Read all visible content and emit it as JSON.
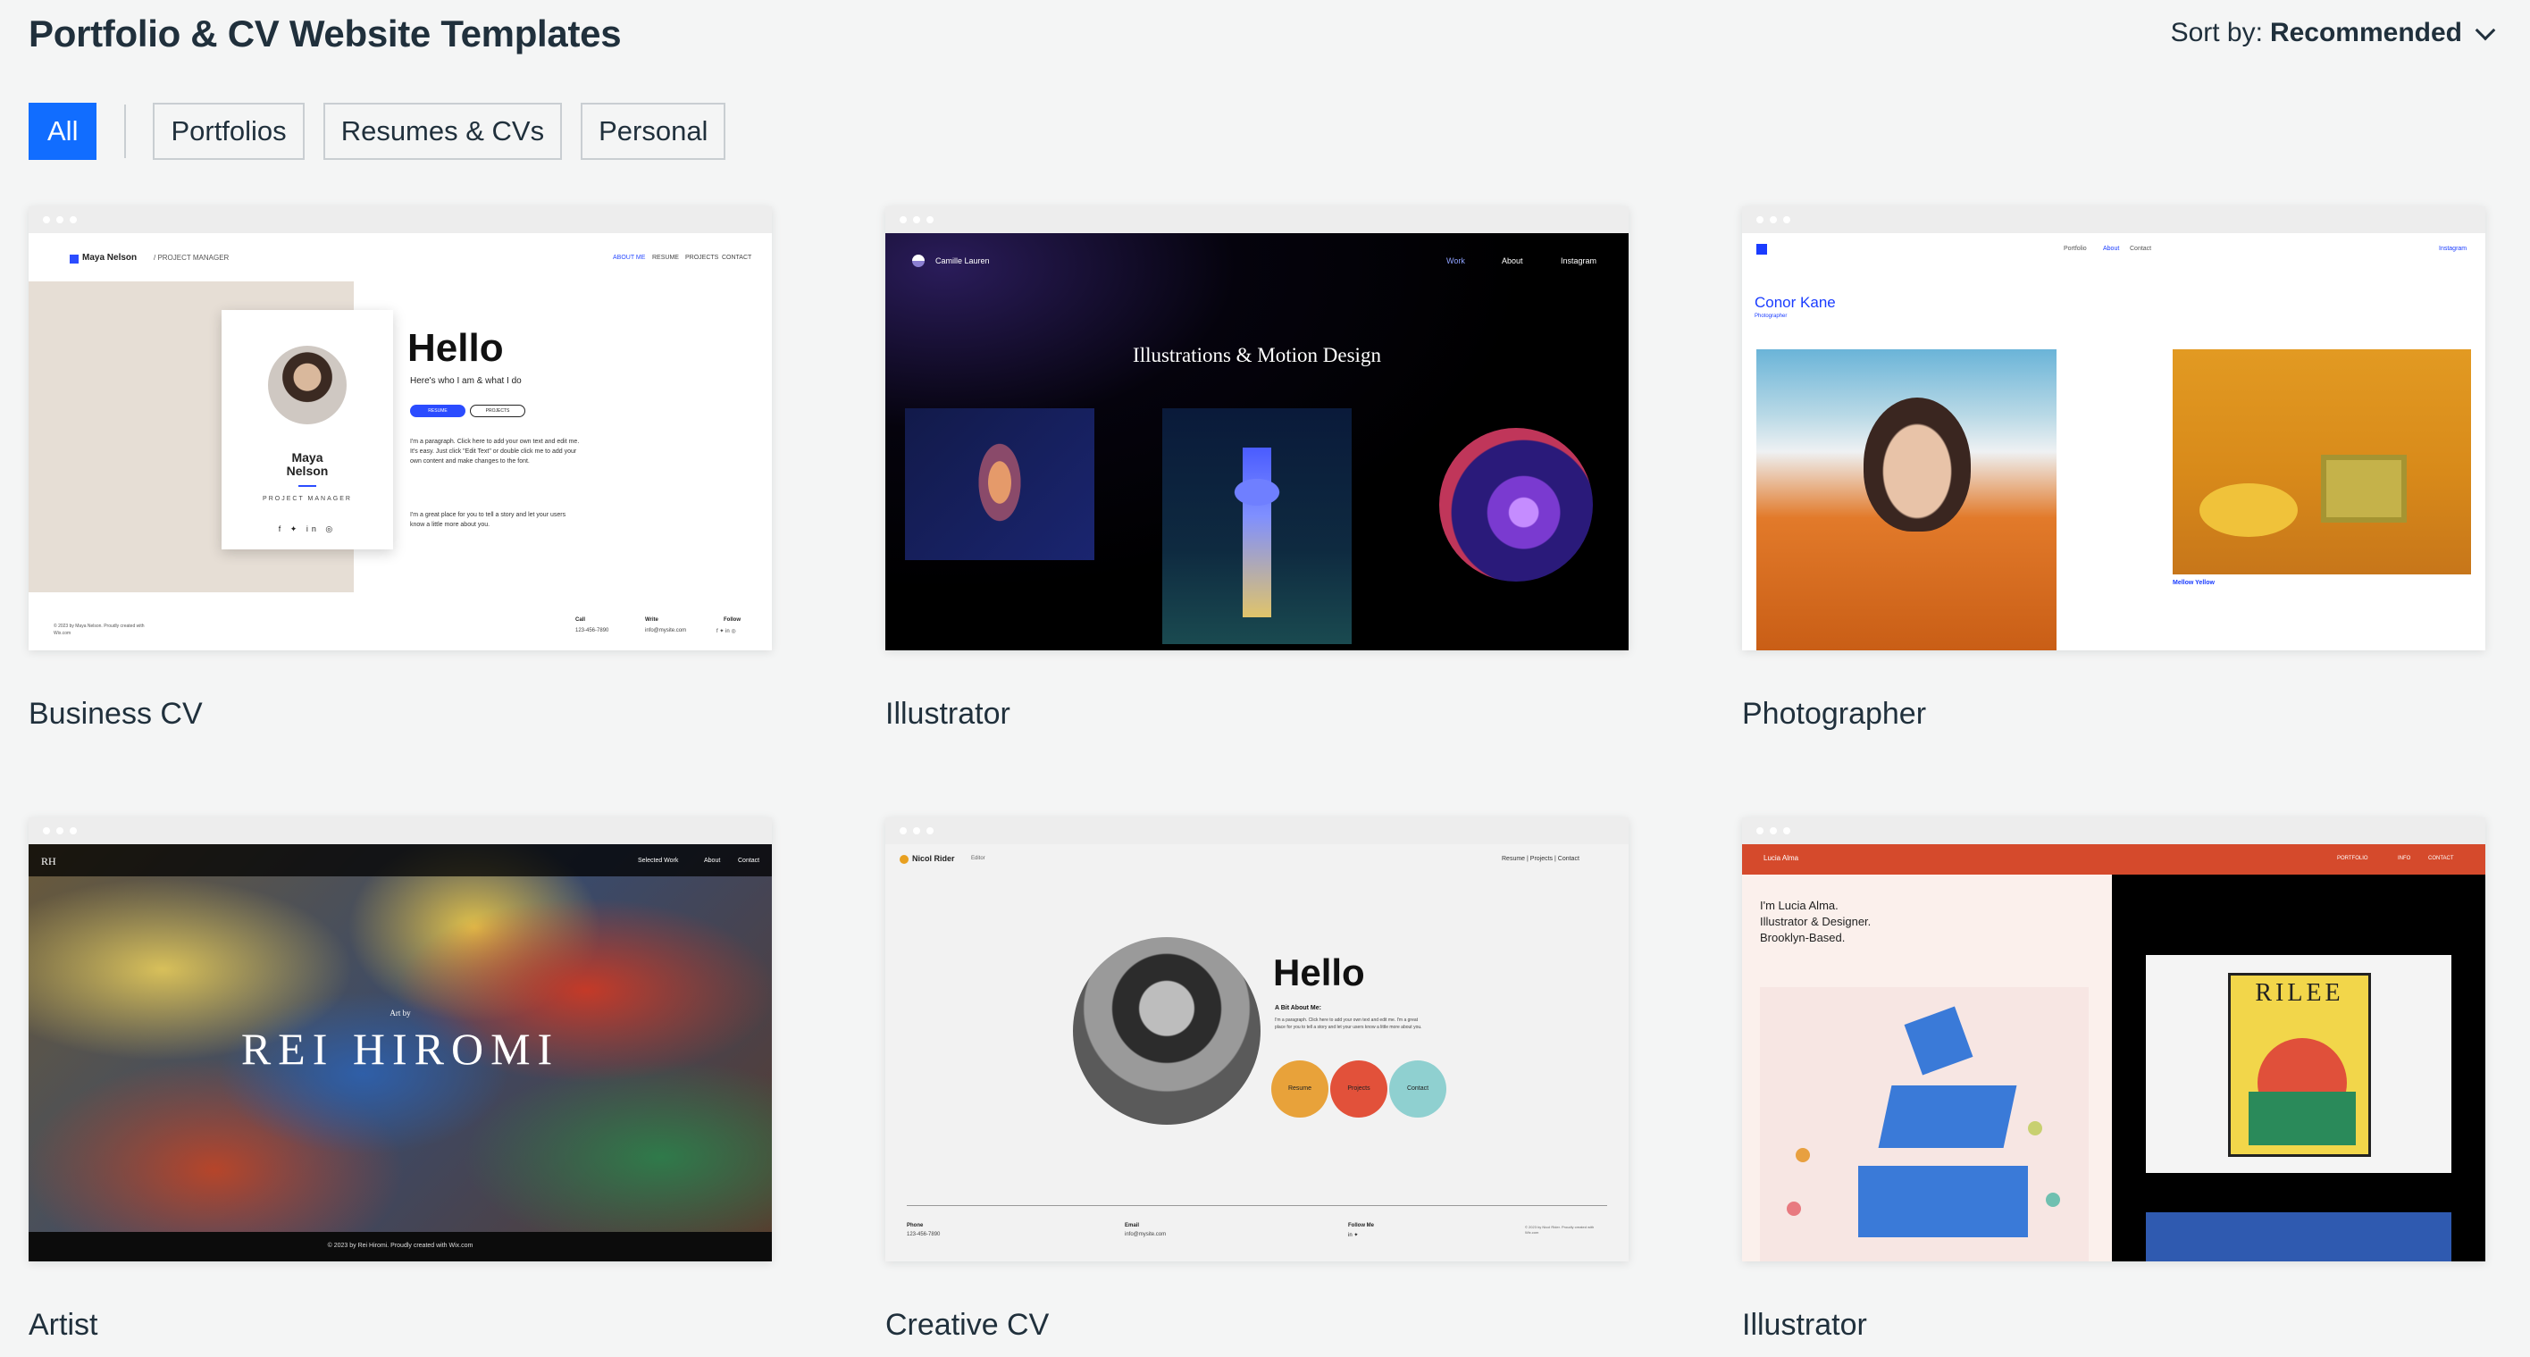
{
  "header": {
    "title": "Portfolio & CV Website Templates",
    "sort_label": "Sort by:",
    "sort_value": "Recommended"
  },
  "filters": [
    "All",
    "Portfolios",
    "Resumes & CVs",
    "Personal"
  ],
  "colors": {
    "accent": "#116dff",
    "page_bg": "#f4f5f5",
    "text": "#20303c"
  },
  "templates": [
    {
      "name": "Business CV",
      "preview": {
        "brand": "Maya Nelson",
        "role_crumb": "/ PROJECT MANAGER",
        "nav": [
          "ABOUT ME",
          "RESUME",
          "PROJECTS",
          "CONTACT"
        ],
        "heading": "Hello",
        "sub": "Here's who I am & what I do",
        "buttons": [
          "RESUME",
          "PROJECTS"
        ],
        "para1": "I'm a paragraph. Click here to add your own text and edit me. It's easy. Just click \"Edit Text\" or double click me to add your own content and make changes to the font.",
        "para2": "I'm a great place for you to tell a story and let your users know a little more about you.",
        "card_name": "Maya Nelson",
        "card_role": "PROJECT MANAGER",
        "footer_left": "© 2023 by Maya Nelson. Proudly created with Wix.com",
        "footer_cols": [
          {
            "label": "Call",
            "value": "123-456-7890"
          },
          {
            "label": "Write",
            "value": "info@mysite.com"
          },
          {
            "label": "Follow",
            "value": "f  ✦  in  ◎"
          }
        ]
      }
    },
    {
      "name": "Illustrator",
      "preview": {
        "brand": "Camille Lauren",
        "nav": [
          "Work",
          "About",
          "Instagram"
        ],
        "heading": "Illustrations & Motion Design"
      }
    },
    {
      "name": "Photographer",
      "preview": {
        "nav": [
          "Portfolio",
          "About",
          "Contact"
        ],
        "social": "Instagram",
        "brand": "Conor Kane",
        "role": "Photographer",
        "caption": "Mellow Yellow"
      }
    },
    {
      "name": "Artist",
      "preview": {
        "brand": "RH",
        "nav": [
          "Selected Work",
          "About",
          "Contact"
        ],
        "small": "Art by",
        "heading": "REI HIROMI",
        "footer": "© 2023 by Rei Hiromi. Proudly created with Wix.com"
      }
    },
    {
      "name": "Creative CV",
      "preview": {
        "brand": "Nicol Rider",
        "role": "Editor",
        "nav": "Resume | Projects | Contact",
        "heading": "Hello",
        "sub": "A Bit About Me:",
        "para": "I'm a paragraph. Click here to add your own text and edit me. I'm a great place for you to tell a story and let your users know a little more about you.",
        "circles": [
          "Resume",
          "Projects",
          "Contact"
        ],
        "footer_cols": [
          {
            "label": "Phone",
            "value": "123-456-7890"
          },
          {
            "label": "Email",
            "value": "info@mysite.com"
          },
          {
            "label": "Follow Me",
            "value": "in ✦"
          }
        ],
        "footer_right": "© 2023 by Nicol Rider. Proudly created with Wix.com"
      }
    },
    {
      "name": "Illustrator",
      "preview": {
        "brand": "Lucia Alma",
        "nav": [
          "PORTFOLIO",
          "INFO",
          "CONTACT"
        ],
        "intro": [
          "I'm Lucia Alma.",
          "Illustrator & Designer.",
          "Brooklyn-Based."
        ],
        "poster": "RILEE"
      }
    }
  ]
}
